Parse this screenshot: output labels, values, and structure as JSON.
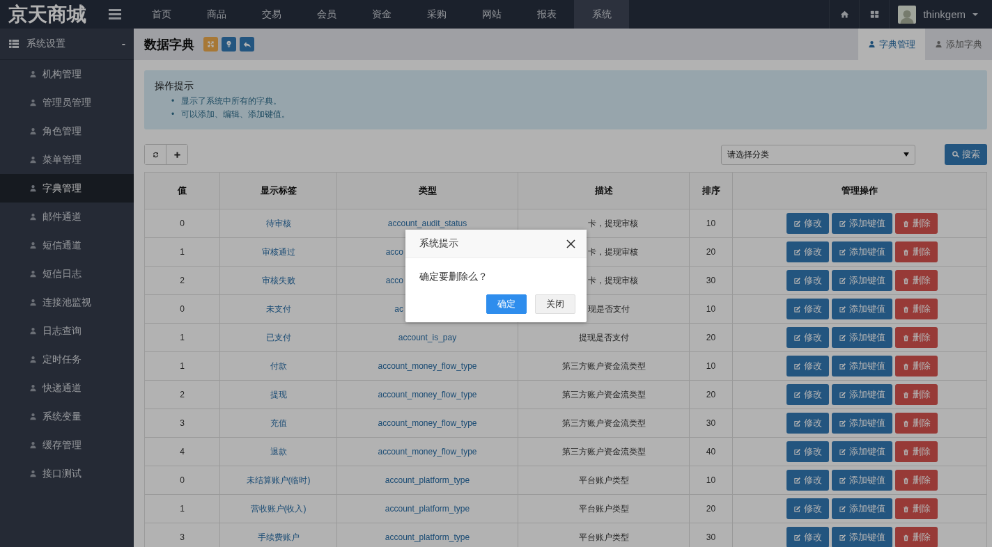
{
  "brand": "京天商城",
  "top_nav": [
    {
      "label": "首页",
      "selected": false
    },
    {
      "label": "商品",
      "selected": false
    },
    {
      "label": "交易",
      "selected": false
    },
    {
      "label": "会员",
      "selected": false
    },
    {
      "label": "资金",
      "selected": false
    },
    {
      "label": "采购",
      "selected": false
    },
    {
      "label": "网站",
      "selected": false
    },
    {
      "label": "报表",
      "selected": false
    },
    {
      "label": "系统",
      "selected": true
    }
  ],
  "user": {
    "name": "thinkgem"
  },
  "sidebar": {
    "group": {
      "label": "系统设置",
      "toggle": "-"
    },
    "items": [
      {
        "label": "机构管理",
        "selected": false
      },
      {
        "label": "管理员管理",
        "selected": false
      },
      {
        "label": "角色管理",
        "selected": false
      },
      {
        "label": "菜单管理",
        "selected": false
      },
      {
        "label": "字典管理",
        "selected": true
      },
      {
        "label": "邮件通道",
        "selected": false
      },
      {
        "label": "短信通道",
        "selected": false
      },
      {
        "label": "短信日志",
        "selected": false
      },
      {
        "label": "连接池监视",
        "selected": false
      },
      {
        "label": "日志查询",
        "selected": false
      },
      {
        "label": "定时任务",
        "selected": false
      },
      {
        "label": "快递通道",
        "selected": false
      },
      {
        "label": "系统变量",
        "selected": false
      },
      {
        "label": "缓存管理",
        "selected": false
      },
      {
        "label": "接口测试",
        "selected": false
      }
    ]
  },
  "page": {
    "title": "数据字典",
    "tabs": [
      {
        "label": "字典管理",
        "selected": true
      },
      {
        "label": "添加字典",
        "selected": false
      }
    ]
  },
  "tips": {
    "title": "操作提示",
    "bullet": "•",
    "items": [
      "显示了系统中所有的字典。",
      "可以添加、编辑、添加键值。"
    ]
  },
  "filter": {
    "select_value": "请选择分类",
    "search_button": "搜索"
  },
  "table": {
    "columns": [
      "值",
      "显示标签",
      "类型",
      "描述",
      "排序",
      "管理操作"
    ],
    "rows": [
      {
        "value": "0",
        "label": "待审核",
        "type": "account_audit_status",
        "type_truncated": false,
        "description": "卡，提现审核",
        "description_truncated": true,
        "order": "10",
        "actions": [
          {
            "label": "修改",
            "kind": "edit"
          },
          {
            "label": "添加键值",
            "kind": "add"
          },
          {
            "label": "删除",
            "kind": "delete"
          }
        ]
      },
      {
        "value": "1",
        "label": "审核通过",
        "type": "acco",
        "type_truncated": true,
        "description": "卡，提现审核",
        "description_truncated": true,
        "order": "20",
        "actions": [
          {
            "label": "修改",
            "kind": "edit"
          },
          {
            "label": "添加键值",
            "kind": "add"
          },
          {
            "label": "删除",
            "kind": "delete"
          }
        ]
      },
      {
        "value": "2",
        "label": "审核失败",
        "type": "acco",
        "type_truncated": true,
        "description": "卡，提现审核",
        "description_truncated": true,
        "order": "30",
        "actions": [
          {
            "label": "修改",
            "kind": "edit"
          },
          {
            "label": "添加键值",
            "kind": "add"
          },
          {
            "label": "删除",
            "kind": "delete"
          }
        ]
      },
      {
        "value": "0",
        "label": "未支付",
        "type": "ac",
        "type_truncated": true,
        "description": "现是否支付",
        "description_truncated": true,
        "order": "10",
        "actions": [
          {
            "label": "修改",
            "kind": "edit"
          },
          {
            "label": "添加键值",
            "kind": "add"
          },
          {
            "label": "删除",
            "kind": "delete"
          }
        ]
      },
      {
        "value": "1",
        "label": "已支付",
        "type": "account_is_pay",
        "description": "提现是否支付",
        "order": "20",
        "actions": [
          {
            "label": "修改",
            "kind": "edit"
          },
          {
            "label": "添加键值",
            "kind": "add"
          },
          {
            "label": "删除",
            "kind": "delete"
          }
        ]
      },
      {
        "value": "1",
        "label": "付款",
        "type": "account_money_flow_type",
        "description": "第三方账户资金流类型",
        "order": "10",
        "actions": [
          {
            "label": "修改",
            "kind": "edit"
          },
          {
            "label": "添加键值",
            "kind": "add"
          },
          {
            "label": "删除",
            "kind": "delete"
          }
        ]
      },
      {
        "value": "2",
        "label": "提现",
        "type": "account_money_flow_type",
        "description": "第三方账户资金流类型",
        "order": "20",
        "actions": [
          {
            "label": "修改",
            "kind": "edit"
          },
          {
            "label": "添加键值",
            "kind": "add"
          },
          {
            "label": "删除",
            "kind": "delete"
          }
        ]
      },
      {
        "value": "3",
        "label": "充值",
        "type": "account_money_flow_type",
        "description": "第三方账户资金流类型",
        "order": "30",
        "actions": [
          {
            "label": "修改",
            "kind": "edit"
          },
          {
            "label": "添加键值",
            "kind": "add"
          },
          {
            "label": "删除",
            "kind": "delete"
          }
        ]
      },
      {
        "value": "4",
        "label": "退款",
        "type": "account_money_flow_type",
        "description": "第三方账户资金流类型",
        "order": "40",
        "actions": [
          {
            "label": "修改",
            "kind": "edit"
          },
          {
            "label": "添加键值",
            "kind": "add"
          },
          {
            "label": "删除",
            "kind": "delete"
          }
        ]
      },
      {
        "value": "0",
        "label": "未结算账户(临时)",
        "type": "account_platform_type",
        "description": "平台账户类型",
        "order": "10",
        "actions": [
          {
            "label": "修改",
            "kind": "edit"
          },
          {
            "label": "添加键值",
            "kind": "add"
          },
          {
            "label": "删除",
            "kind": "delete"
          }
        ]
      },
      {
        "value": "1",
        "label": "营收账户(收入)",
        "type": "account_platform_type",
        "description": "平台账户类型",
        "order": "20",
        "actions": [
          {
            "label": "修改",
            "kind": "edit"
          },
          {
            "label": "添加键值",
            "kind": "add"
          },
          {
            "label": "删除",
            "kind": "delete"
          }
        ]
      },
      {
        "value": "3",
        "label": "手续费账户",
        "type": "account_platform_type",
        "description": "平台账户类型",
        "order": "30",
        "actions": [
          {
            "label": "修改",
            "kind": "edit"
          },
          {
            "label": "添加键值",
            "kind": "add"
          },
          {
            "label": "删除",
            "kind": "delete"
          }
        ]
      }
    ]
  },
  "dialog": {
    "title": "系统提示",
    "message": "确定要删除么？",
    "buttons": [
      {
        "label": "确定",
        "kind": "primary"
      },
      {
        "label": "关闭",
        "kind": "default"
      }
    ]
  }
}
